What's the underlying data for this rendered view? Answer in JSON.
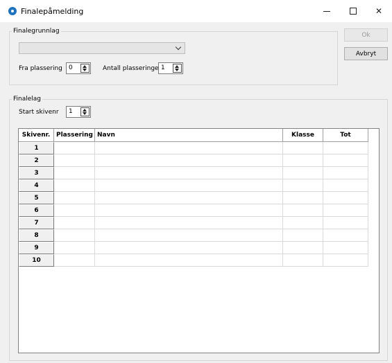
{
  "window": {
    "title": "Finalepåmelding",
    "app_icon": "clock-icon"
  },
  "group_basis": {
    "label": "Finalegrunnlag",
    "dropdown_value": "",
    "from_place_label": "Fra plassering",
    "from_place_value": "0",
    "count_label": "Antall plasseringer",
    "count_value": "1"
  },
  "buttons": {
    "ok": "Ok",
    "cancel": "Avbryt"
  },
  "group_team": {
    "label": "Finalelag",
    "start_label": "Start skivenr",
    "start_value": "1"
  },
  "table": {
    "columns": [
      "Skivenr.",
      "Plassering",
      "Navn",
      "Klasse",
      "Tot"
    ],
    "rows": [
      "1",
      "2",
      "3",
      "4",
      "5",
      "6",
      "7",
      "8",
      "9",
      "10"
    ]
  }
}
